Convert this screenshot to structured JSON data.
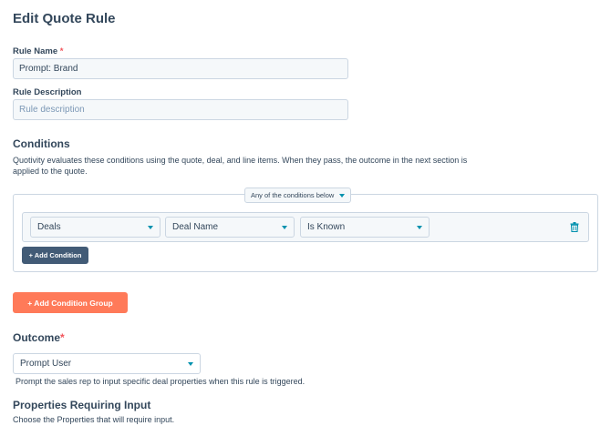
{
  "page": {
    "title": "Edit Quote Rule"
  },
  "rule_name": {
    "label": "Rule Name",
    "required_mark": "*",
    "value": "Prompt: Brand"
  },
  "rule_description": {
    "label": "Rule Description",
    "placeholder": "Rule description",
    "value": ""
  },
  "conditions": {
    "title": "Conditions",
    "description": "Quotivity evaluates these conditions using the quote, deal, and line items. When they pass, the outcome in the next section is applied to the quote.",
    "group": {
      "match_label": "Any of the conditions below",
      "rows": [
        {
          "object": "Deals",
          "property": "Deal Name",
          "operator": "Is Known"
        }
      ],
      "add_condition_label": "+ Add Condition"
    },
    "add_group_label": "+ Add Condition Group"
  },
  "outcome": {
    "title": "Outcome",
    "required_mark": "*",
    "selected": "Prompt User",
    "help": "Prompt the sales rep to input specific deal properties when this rule is triggered."
  },
  "properties_input": {
    "title": "Properties Requiring Input",
    "description": "Choose the Properties that will require input."
  },
  "icons": {
    "trash": "trash-icon",
    "caret": "chevron-down-icon"
  },
  "colors": {
    "accent": "#ff7a59",
    "link": "#0091ae",
    "dark_button": "#425b76",
    "text": "#33475b"
  }
}
